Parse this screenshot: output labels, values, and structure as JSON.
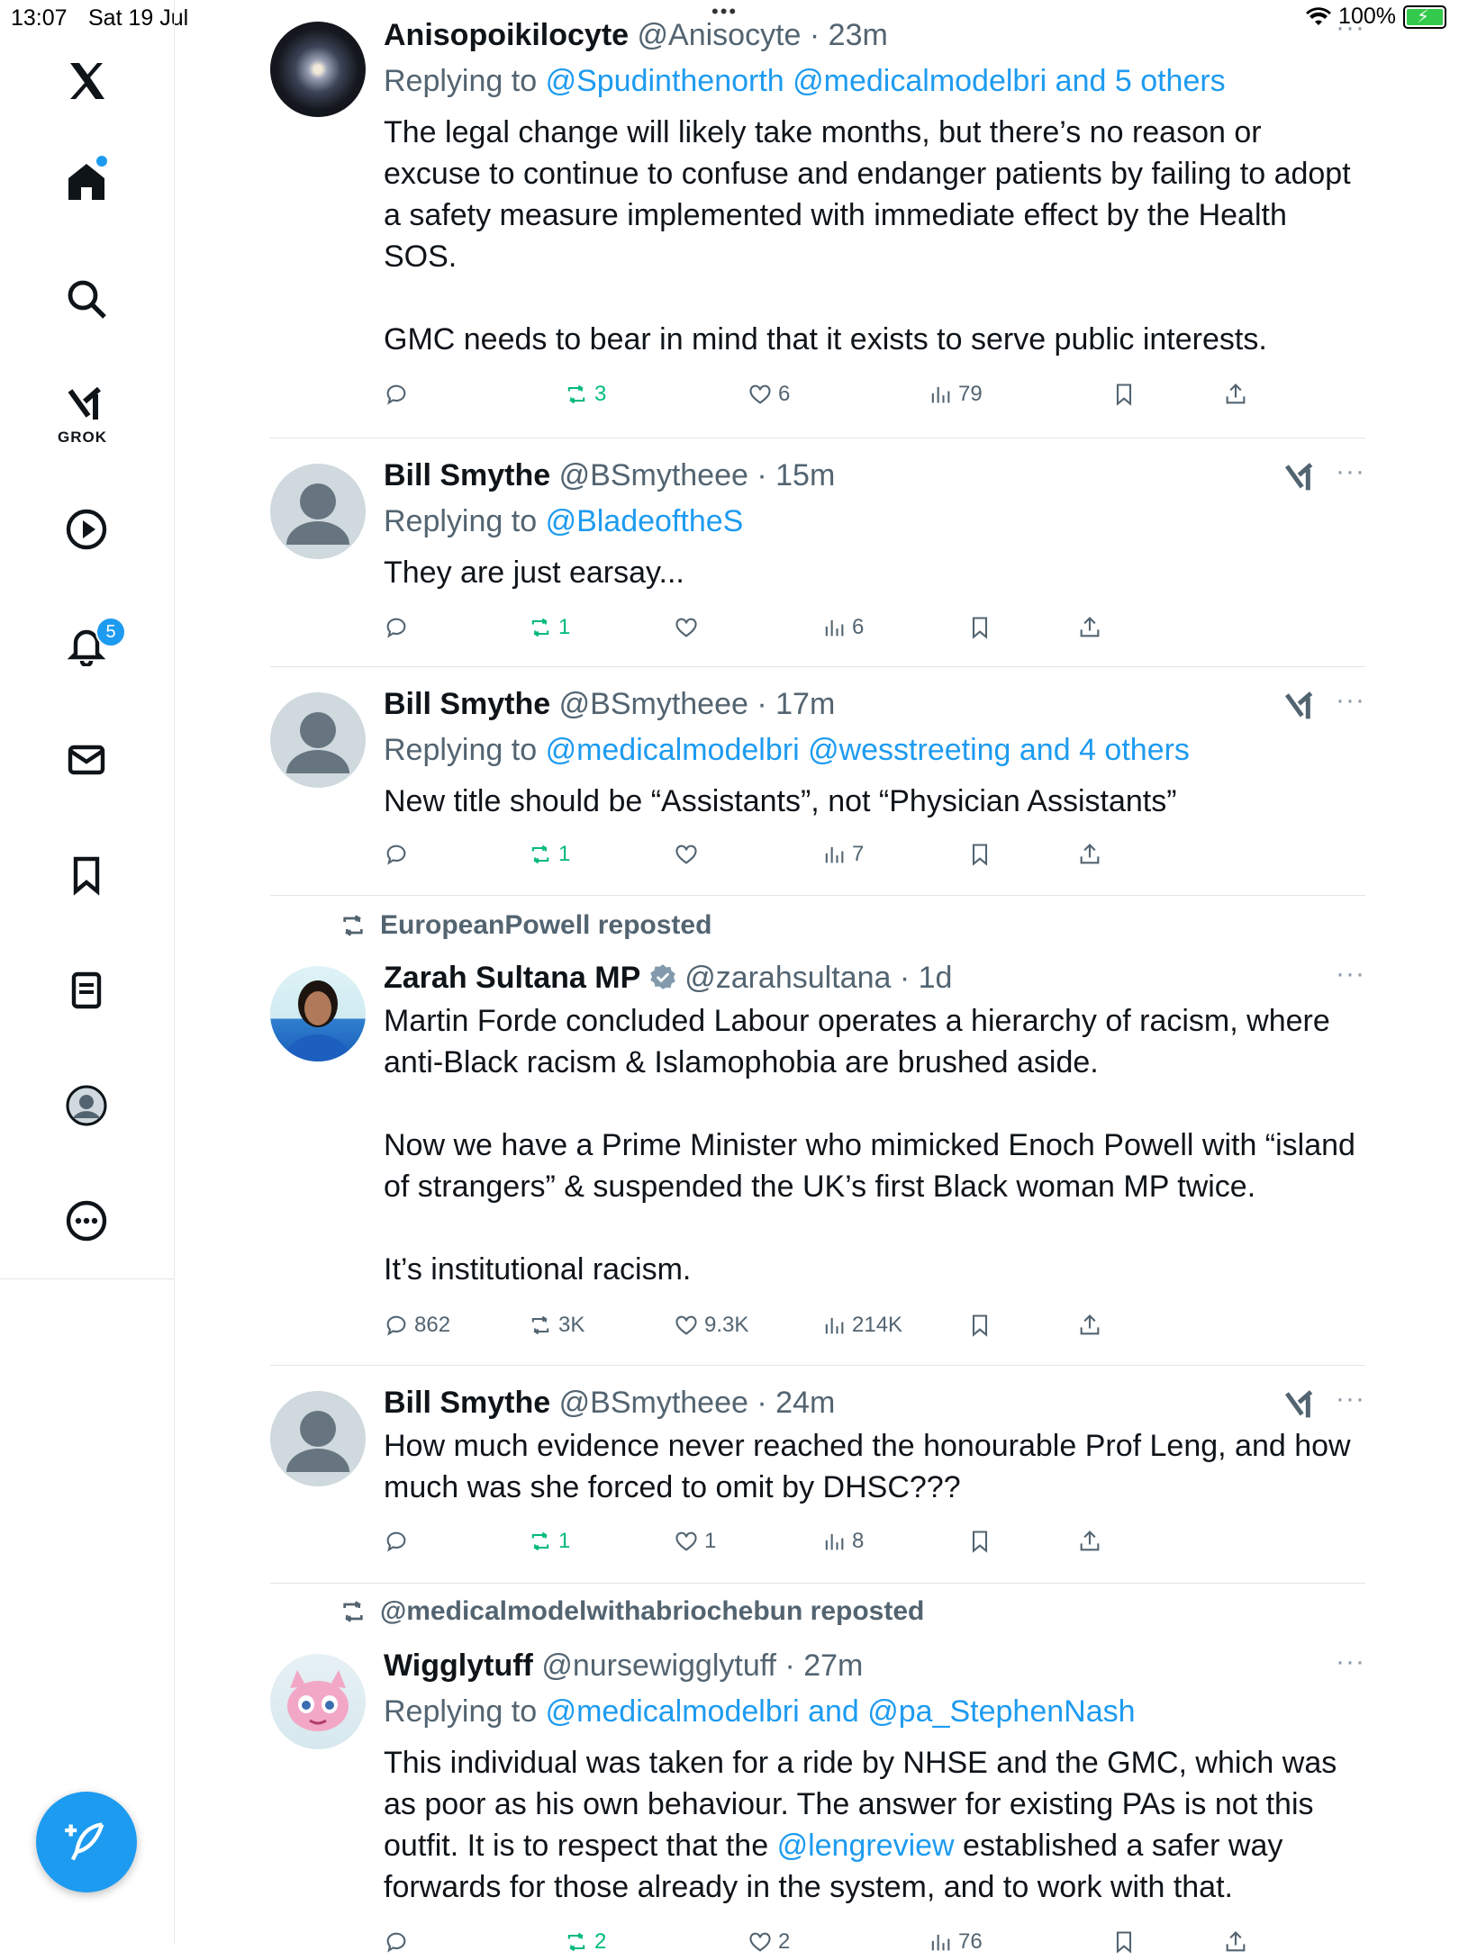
{
  "status_bar": {
    "time": "13:07",
    "date": "Sat 19 Jul",
    "battery": "100%"
  },
  "sidebar": {
    "grok_label": "GROK",
    "notifications_badge": "5",
    "items": [
      "x-logo",
      "home",
      "search",
      "grok",
      "video",
      "notifications",
      "messages",
      "bookmarks",
      "lists",
      "profile",
      "more"
    ]
  },
  "tweets": [
    {
      "name": "Anisopoikilocyte",
      "handle": "@Anisocyte",
      "time": "23m",
      "reply_prefix": "Replying to",
      "reply_mentions": "@Spudinthenorth @medicalmodelbri and 5 others",
      "body_p1": "The legal change will likely take months, but there’s no reason or excuse to continue to confuse and endanger patients by failing to adopt a safety measure implemented with immediate effect by the Health SOS.",
      "body_p2": "GMC needs to bear in mind that it exists to serve public interests.",
      "replies": "",
      "reposts": "3",
      "likes": "6",
      "views": "79"
    },
    {
      "name": "Bill Smythe",
      "handle": "@BSmytheee",
      "time": "15m",
      "reply_prefix": "Replying to",
      "reply_mentions": "@BladeoftheS",
      "body_p1": "They are just earsay...",
      "replies": "",
      "reposts": "1",
      "likes": "",
      "views": "6"
    },
    {
      "name": "Bill Smythe",
      "handle": "@BSmytheee",
      "time": "17m",
      "reply_prefix": "Replying to",
      "reply_mentions": "@medicalmodelbri @wesstreeting and 4 others",
      "body_p1": "New title should be “Assistants”, not “Physician Assistants”",
      "replies": "",
      "reposts": "1",
      "likes": "",
      "views": "7"
    },
    {
      "reposted_by": "EuropeanPowell reposted",
      "name": "Zarah Sultana MP",
      "handle": "@zarahsultana",
      "time": "1d",
      "body_p1": "Martin Forde concluded Labour operates a hierarchy of racism, where anti-Black racism & Islamophobia are brushed aside.",
      "body_p2": "Now we have a Prime Minister who mimicked Enoch Powell with “island of strangers” & suspended the UK’s first Black woman MP twice.",
      "body_p3": "It’s institutional racism.",
      "replies": "862",
      "reposts": "3K",
      "likes": "9.3K",
      "views": "214K"
    },
    {
      "name": "Bill Smythe",
      "handle": "@BSmytheee",
      "time": "24m",
      "body_p1": "How much evidence never reached the honourable Prof Leng, and how much was she forced to omit by DHSC???",
      "replies": "",
      "reposts": "1",
      "likes": "1",
      "views": "8"
    },
    {
      "reposted_by": "@medicalmodelwithabriochebun reposted",
      "name": "Wigglytuff",
      "handle": "@nursewigglytuff",
      "time": "27m",
      "reply_prefix": "Replying to",
      "reply_mentions": "@medicalmodelbri and @pa_StephenNash",
      "body_a": "This individual was taken for a ride by NHSE and the GMC, which was as poor as his own behaviour. The answer for existing PAs is not this outfit. It is to respect that the ",
      "body_mention": "@lengreview",
      "body_b": " established a safer way forwards for those already in the system, and to work with that.",
      "reposts": "2",
      "likes": "2",
      "views": "76"
    }
  ],
  "colors": {
    "accent": "#1d9bf0",
    "repost_green": "#00ba7c",
    "secondary_text": "#536471"
  }
}
